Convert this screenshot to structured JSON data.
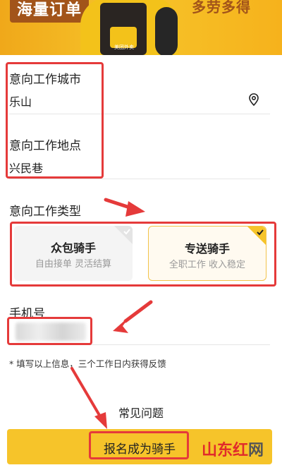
{
  "banner": {
    "left_text": "海量订单",
    "right_text": "多劳多得",
    "bag_logo": "美团外卖"
  },
  "form": {
    "city": {
      "label": "意向工作城市",
      "value": "乐山"
    },
    "place": {
      "label": "意向工作地点",
      "value": "兴民巷"
    },
    "type_label": "意向工作类型",
    "types": [
      {
        "title": "众包骑手",
        "sub": "自由接单 灵活结算"
      },
      {
        "title": "专送骑手",
        "sub": "全职工作 收入稳定"
      }
    ],
    "phone_label": "手机号",
    "note": "* 填写以上信息，三个工作日内获得反馈"
  },
  "faq": "常见问题",
  "submit": "报名成为骑手",
  "watermark": {
    "part1": "山东红",
    "part2": "网"
  },
  "colors": {
    "accent": "#f6c42a",
    "annotation": "#e53a3a"
  }
}
